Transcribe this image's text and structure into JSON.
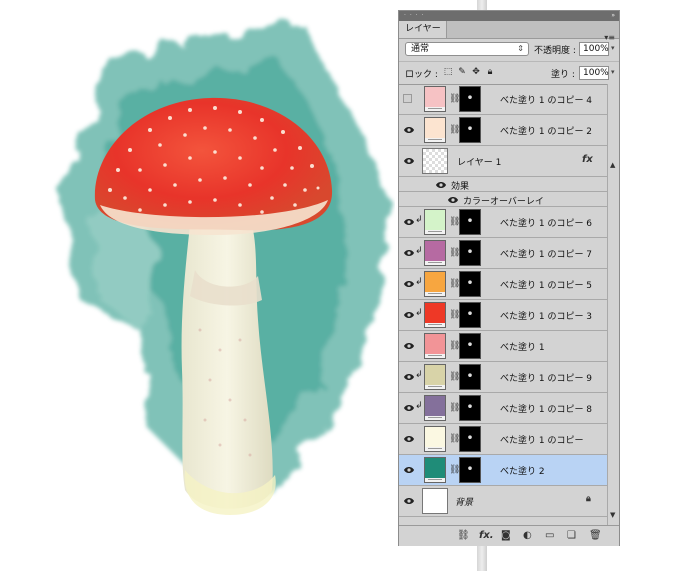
{
  "layers_panel": {
    "tab_label": "レイヤー",
    "panel_menu_icon": "panel-menu-icon",
    "blend_mode": "通常",
    "opacity_label": "不透明度 :",
    "opacity_value": "100%",
    "lock_label": "ロック :",
    "fill_label": "塗り :",
    "fill_value": "100%",
    "layers": [
      {
        "name": "べた塗り 1 のコピー 4",
        "color": "#f6c2c4",
        "visible": false,
        "clipped": false
      },
      {
        "name": "べた塗り 1 のコピー 2",
        "color": "#fce4d0",
        "visible": true,
        "clipped": false
      },
      {
        "name": "レイヤー 1",
        "type": "pixel",
        "visible": true,
        "fx": "fx"
      },
      {
        "name": "効果",
        "type": "effects-header",
        "visible": true
      },
      {
        "name": "カラーオーバーレイ",
        "type": "effect",
        "visible": true
      },
      {
        "name": "べた塗り 1 のコピー 6",
        "color": "#d4f3c9",
        "visible": true,
        "clipped": true
      },
      {
        "name": "べた塗り 1 のコピー 7",
        "color": "#b66aa2",
        "visible": true,
        "clipped": true
      },
      {
        "name": "べた塗り 1 のコピー 5",
        "color": "#f7a640",
        "visible": true,
        "clipped": true
      },
      {
        "name": "べた塗り 1 のコピー 3",
        "color": "#ee3826",
        "visible": true,
        "clipped": true
      },
      {
        "name": "べた塗り 1",
        "color": "#f29497",
        "visible": true,
        "clipped": false
      },
      {
        "name": "べた塗り 1 のコピー 9",
        "color": "#d8d3a8",
        "visible": true,
        "clipped": true
      },
      {
        "name": "べた塗り 1 のコピー 8",
        "color": "#84709b",
        "visible": true,
        "clipped": true
      },
      {
        "name": "べた塗り 1 のコピー",
        "color": "#fbf8e2",
        "visible": true,
        "clipped": false
      },
      {
        "name": "べた塗り 2",
        "color": "#1f8c78",
        "visible": true,
        "clipped": false,
        "selected": true
      },
      {
        "name": "背景",
        "type": "background",
        "visible": true
      }
    ],
    "footer_icons": [
      "link-layers-icon",
      "fx-icon",
      "add-mask-icon",
      "adjustment-layer-icon",
      "new-group-icon",
      "new-layer-icon",
      "delete-layer-icon"
    ]
  }
}
